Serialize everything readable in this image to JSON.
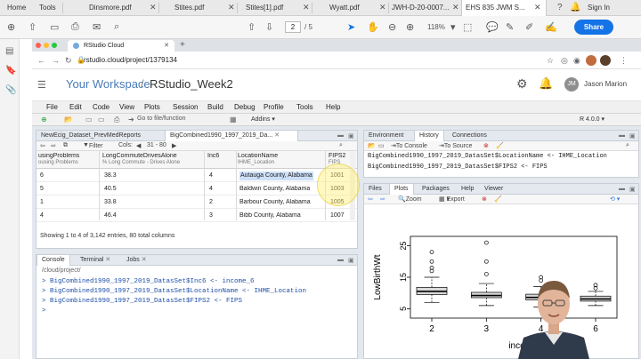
{
  "acrobat": {
    "home": "Home",
    "tools": "Tools",
    "tabs": [
      "Dinsmore.pdf",
      "Stites.pdf",
      "Stites[1].pdf",
      "Wyatt.pdf",
      "JWH-D-20-0007...",
      "EHS 835 JWM S..."
    ],
    "page_current": "2",
    "page_total": "/ 5",
    "zoom": "118%",
    "sign_in": "Sign In",
    "share": "Share"
  },
  "browser": {
    "tab_title": "RStudio Cloud",
    "url": "rstudio.cloud/project/1379134"
  },
  "rstudio_cloud": {
    "workspace": "Your Workspace",
    "separator": "/",
    "project": "RStudio_Week2",
    "user_initials": "JM",
    "user_name": "Jason Marion"
  },
  "ide": {
    "menu": [
      "File",
      "Edit",
      "Code",
      "View",
      "Plots",
      "Session",
      "Build",
      "Debug",
      "Profile",
      "Tools",
      "Help"
    ],
    "goto_placeholder": "Go to file/function",
    "addins": "Addins",
    "r_version": "R 4.0.0",
    "source": {
      "tabs": [
        "NewEcig_Dataset_PrevMedReports",
        "BigCombined1990_1997_2019_Da..."
      ],
      "filter": "Filter",
      "cols": "Cols:",
      "col_range": "31 - 80",
      "headers": [
        {
          "name": "usingProblems",
          "sub": "ousing Problems"
        },
        {
          "name": "LongCommuteDrivesAlone",
          "sub": "% Long Commute - Drives Alone"
        },
        {
          "name": "Inc6",
          "sub": ""
        },
        {
          "name": "LocationName",
          "sub": "IHME_Location"
        },
        {
          "name": "FIPS2",
          "sub": "FIPS"
        }
      ],
      "rows": [
        [
          "6",
          "38.3",
          "4",
          "Autauga County, Alabama",
          "1001"
        ],
        [
          "5",
          "40.5",
          "4",
          "Baldwin County, Alabama",
          "1003"
        ],
        [
          "1",
          "33.8",
          "2",
          "Barbour County, Alabama",
          "1005"
        ],
        [
          "4",
          "46.4",
          "3",
          "Bibb County, Alabama",
          "1007"
        ]
      ],
      "status": "Showing 1 to 4 of 3,142 entries, 80 total columns"
    },
    "console": {
      "tabs": [
        "Console",
        "Terminal",
        "Jobs"
      ],
      "path": "/cloud/project/",
      "lines": [
        "> BigCombined1990_1997_2019_DatasSet$Inc6 <- income_6",
        "> BigCombined1990_1997_2019_DatasSet$LocationName <- IHME_Location",
        "> BigCombined1990_1997_2019_DatasSet$FIPS2 <- FIPS",
        ">"
      ]
    },
    "environment": {
      "tabs": [
        "Environment",
        "History",
        "Connections"
      ],
      "to_console": "To Console",
      "to_source": "To Source",
      "history": [
        "BigCombined1990_1997_2019_DatasSet$LocationName <- IHME_Location",
        "BigCombined1990_1997_2019_DatasSet$FIPS2 <- FIPS"
      ]
    },
    "files": {
      "tabs": [
        "Files",
        "Plots",
        "Packages",
        "Help",
        "Viewer"
      ],
      "zoom": "Zoom",
      "export": "Export"
    }
  },
  "chart_data": {
    "type": "boxplot",
    "xlabel": "income_6",
    "ylabel": "LowBirthWt",
    "categories": [
      "2",
      "3",
      "4",
      "6"
    ],
    "y_ticks": [
      5,
      15,
      25
    ],
    "boxes": [
      {
        "category": "2",
        "q1": 9.5,
        "median": 10.5,
        "q3": 11.8,
        "whisker_low": 7,
        "whisker_high": 15,
        "outliers": [
          17,
          18,
          20,
          23
        ]
      },
      {
        "category": "3",
        "q1": 8.5,
        "median": 9.2,
        "q3": 10.2,
        "whisker_low": 6,
        "whisker_high": 13,
        "outliers": [
          16,
          20,
          26
        ]
      },
      {
        "category": "4",
        "q1": 7.8,
        "median": 8.6,
        "q3": 9.6,
        "whisker_low": 5.5,
        "whisker_high": 12,
        "outliers": [
          14,
          15
        ]
      },
      {
        "category": "6",
        "q1": 7.4,
        "median": 8.1,
        "q3": 9.0,
        "whisker_low": 6,
        "whisker_high": 10.5,
        "outliers": [
          11.5,
          12.5
        ]
      }
    ]
  }
}
